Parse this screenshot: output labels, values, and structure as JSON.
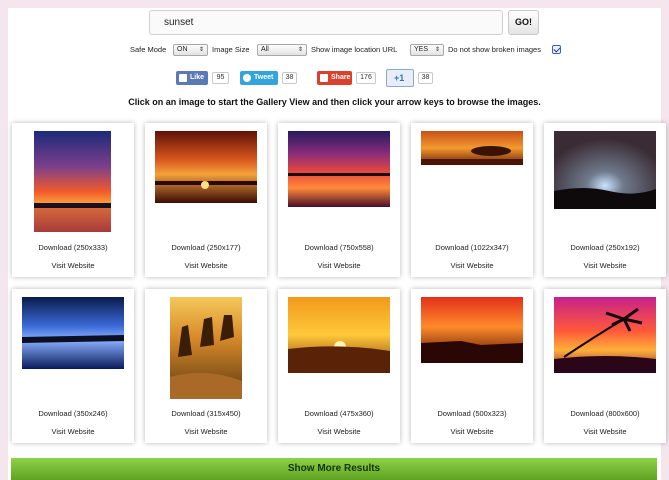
{
  "search": {
    "value": "sunset",
    "go_label": "GO!"
  },
  "options": {
    "safe_mode_label": "Safe Mode",
    "safe_mode_value": "ON",
    "image_size_label": "Image Size",
    "image_size_value": "All",
    "location_label": "Show image location URL",
    "location_value": "YES",
    "broken_label": "Do not show broken images",
    "broken_checked": true
  },
  "social": {
    "like_label": "Like",
    "like_count": "95",
    "tweet_label": "Tweet",
    "tweet_count": "38",
    "share_label": "Share",
    "share_count": "176",
    "plusone_label": "+1",
    "plusone_count": "38"
  },
  "instruction": "Click on an image to start the Gallery View and then click your arrow keys to browse the images.",
  "results": [
    {
      "download": "Download (250x333)",
      "visit": "Visit Website"
    },
    {
      "download": "Download (250x177)",
      "visit": "Visit Website"
    },
    {
      "download": "Download (750x558)",
      "visit": "Visit Website"
    },
    {
      "download": "Download (1022x347)",
      "visit": "Visit Website"
    },
    {
      "download": "Download (250x192)",
      "visit": "Visit Website"
    },
    {
      "download": "Download (350x246)",
      "visit": "Visit Website"
    },
    {
      "download": "Download (315x450)",
      "visit": "Visit Website"
    },
    {
      "download": "Download (475x360)",
      "visit": "Visit Website"
    },
    {
      "download": "Download (500x323)",
      "visit": "Visit Website"
    },
    {
      "download": "Download (800x600)",
      "visit": "Visit Website"
    }
  ],
  "more_results": "Show More Results",
  "colors": {
    "facebook": "#3b5998",
    "twitter": "#2a9fd6",
    "share": "#d9412d",
    "plusone": "#2f6fd1",
    "more_bar": "#74b934"
  }
}
